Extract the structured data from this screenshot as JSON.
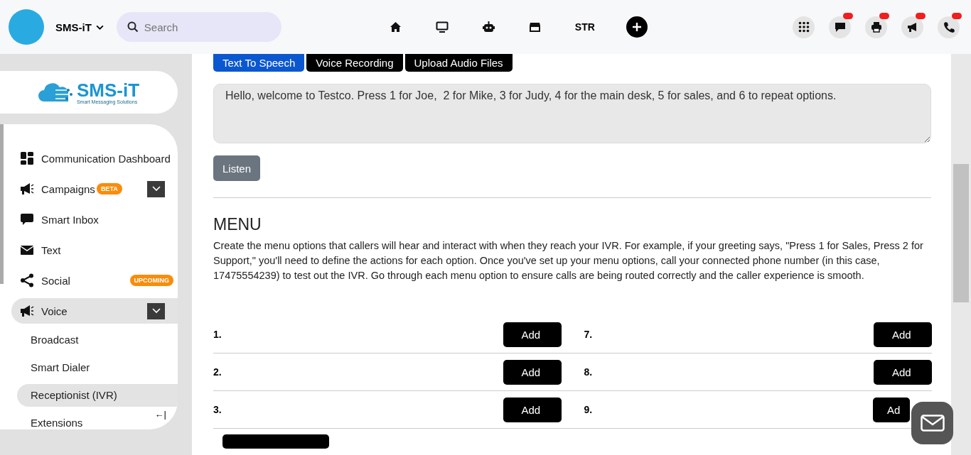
{
  "header": {
    "brand": "SMS-iT",
    "search": {
      "placeholder": "Search"
    },
    "nav": [
      {
        "kind": "icon"
      },
      {
        "kind": "icon"
      },
      {
        "kind": "icon"
      },
      {
        "kind": "icon"
      },
      {
        "kind": "text",
        "label": "STR"
      },
      {
        "kind": "plus"
      }
    ],
    "actions": [
      {
        "badge": false
      },
      {
        "badge": true
      },
      {
        "badge": true
      },
      {
        "badge": true
      },
      {
        "badge": true
      }
    ]
  },
  "sidebar": {
    "logo": {
      "title": "SMS-iT",
      "tagline": "Smart Messaging Solutions"
    },
    "items": [
      {
        "label": "Communication Dashboard",
        "selected": false
      },
      {
        "label": "Campaigns",
        "badge": "BETA",
        "expandable": true,
        "selected": false
      },
      {
        "label": "Smart Inbox",
        "selected": false
      },
      {
        "label": "Text",
        "selected": false
      },
      {
        "label": "Social",
        "badge": "UPCOMING",
        "selected": false
      },
      {
        "label": "Voice",
        "expandable": true,
        "selected": true,
        "children": [
          {
            "label": "Broadcast",
            "selected": false
          },
          {
            "label": "Smart Dialer",
            "selected": false
          },
          {
            "label": "Receptionist (IVR)",
            "selected": true
          },
          {
            "label": "Extensions",
            "selected": false
          }
        ]
      }
    ],
    "collapse": "←|"
  },
  "main": {
    "tabs": [
      {
        "label": "Text To Speech",
        "selected": true
      },
      {
        "label": "Voice Recording",
        "selected": false
      },
      {
        "label": "Upload Audio Files",
        "selected": false
      }
    ],
    "greeting": "Hello, welcome to Testco. Press 1 for Joe,  2 for Mike, 3 for Judy, 4 for the main desk, 5 for sales, and 6 to repeat options.",
    "listen": "Listen",
    "menu_title": "MENU",
    "menu_description": "Create the menu options that callers will hear and interact with when they reach your IVR. For example, if your greeting says, \"Press 1 for Sales, Press 2 for Support,\" you'll need to define the actions for each option. Once you've set up your menu options, call your connected phone number (in this case, 17475554239) to test out the IVR. Go through each menu option to ensure calls are being routed correctly and the caller experience is smooth.",
    "options": [
      [
        {
          "number": "1.",
          "button": "Add"
        },
        {
          "number": "7.",
          "button": "Add"
        }
      ],
      [
        {
          "number": "2.",
          "button": "Add"
        },
        {
          "number": "8.",
          "button": "Add"
        }
      ],
      [
        {
          "number": "3.",
          "button": "Add"
        },
        {
          "number": "9.",
          "button": "Ad"
        }
      ]
    ]
  }
}
